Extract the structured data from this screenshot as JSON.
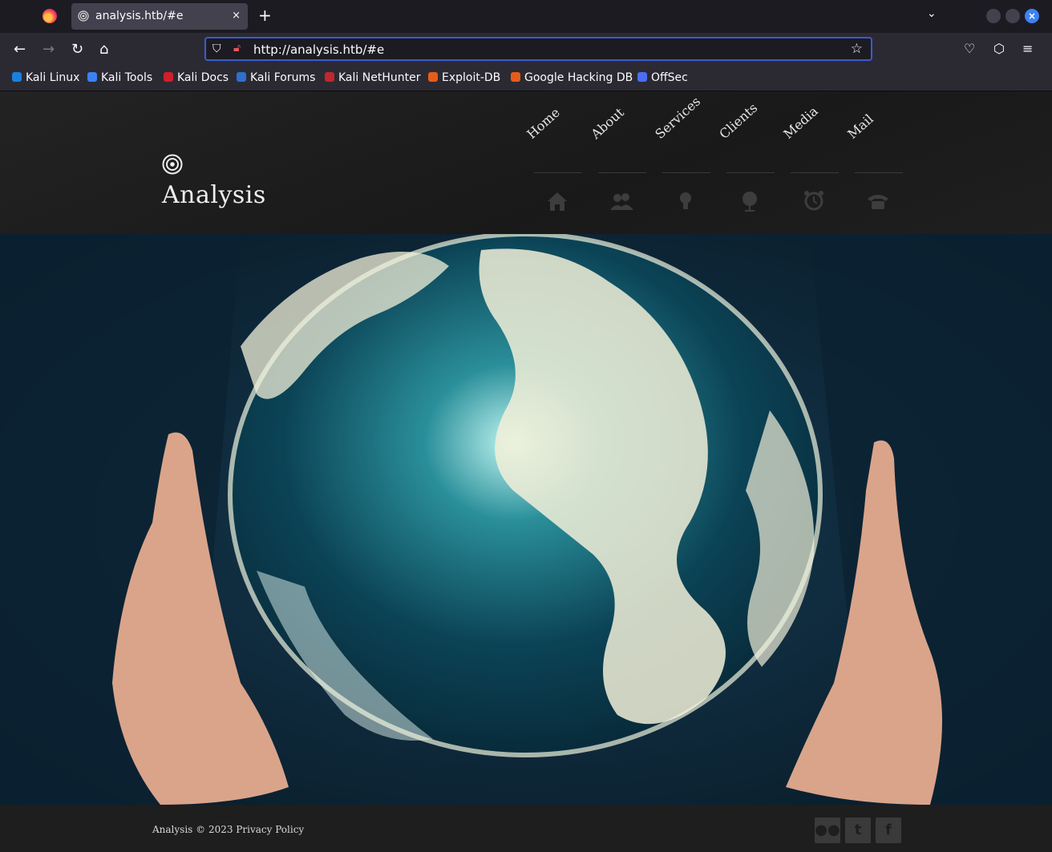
{
  "browser": {
    "tab_title": "analysis.htb/#e",
    "tab_close": "×",
    "new_tab": "+",
    "tab_list": "⌄",
    "window_close": "×",
    "url": "http://analysis.htb/#e",
    "nav": {
      "back": "←",
      "forward": "→",
      "reload": "↻",
      "home": "⌂"
    },
    "url_star": "☆",
    "right_buttons": {
      "pocket": "♡",
      "extensions": "⬡",
      "menu": "≡"
    }
  },
  "bookmarks": [
    {
      "label": "Kali Linux",
      "color": "#1b7fe0"
    },
    {
      "label": "Kali Tools",
      "color": "#3b82f6"
    },
    {
      "label": "Kali Docs",
      "color": "#d11f2b"
    },
    {
      "label": "Kali Forums",
      "color": "#2f6fd0"
    },
    {
      "label": "Kali NetHunter",
      "color": "#c2262e"
    },
    {
      "label": "Exploit-DB",
      "color": "#e65c1a"
    },
    {
      "label": "Google Hacking DB",
      "color": "#e65c1a"
    },
    {
      "label": "OffSec",
      "color": "#4c6ef5"
    }
  ],
  "site": {
    "logo_text": "Analysis",
    "menu": [
      {
        "label": "Home",
        "icon": "house-icon"
      },
      {
        "label": "About",
        "icon": "people-icon"
      },
      {
        "label": "Services",
        "icon": "lightbulb-icon"
      },
      {
        "label": "Clients",
        "icon": "globe-icon"
      },
      {
        "label": "Media",
        "icon": "alarm-clock-icon"
      },
      {
        "label": "Mail",
        "icon": "telephone-icon"
      }
    ],
    "footer_text": "Analysis © 2023 Privacy Policy",
    "social": [
      {
        "name": "flickr-icon",
        "glyph": "●●"
      },
      {
        "name": "twitter-icon",
        "glyph": "t"
      },
      {
        "name": "facebook-icon",
        "glyph": "f"
      }
    ]
  }
}
